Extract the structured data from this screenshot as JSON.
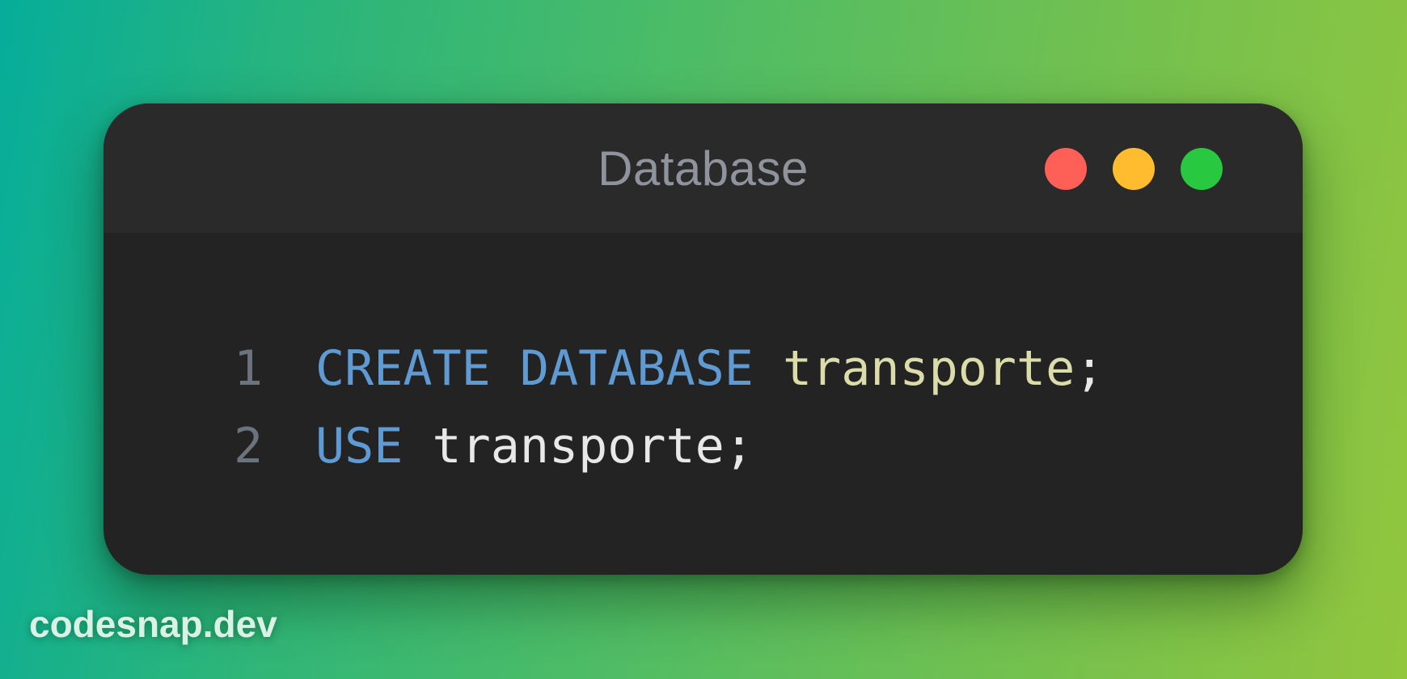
{
  "window": {
    "title": "Database",
    "controls": [
      {
        "name": "close",
        "color": "#fe5f57"
      },
      {
        "name": "minimize",
        "color": "#febc2e"
      },
      {
        "name": "maximize",
        "color": "#28c840"
      }
    ]
  },
  "code": {
    "language": "sql",
    "lines": [
      {
        "number": "1",
        "tokens": [
          {
            "text": "CREATE",
            "kind": "keyword"
          },
          {
            "text": " ",
            "kind": "text"
          },
          {
            "text": "DATABASE",
            "kind": "keyword"
          },
          {
            "text": " ",
            "kind": "text"
          },
          {
            "text": "transporte",
            "kind": "identifier"
          },
          {
            "text": ";",
            "kind": "text"
          }
        ]
      },
      {
        "number": "2",
        "tokens": [
          {
            "text": "USE",
            "kind": "keyword"
          },
          {
            "text": " ",
            "kind": "text"
          },
          {
            "text": "transporte",
            "kind": "text"
          },
          {
            "text": ";",
            "kind": "text"
          }
        ]
      }
    ],
    "colors": {
      "keyword": "#5f9ad3",
      "identifier": "#dcdcaa",
      "text": "#e8e8e8",
      "line_number": "#6b737c"
    }
  },
  "watermark": {
    "text": "codesnap.dev"
  }
}
